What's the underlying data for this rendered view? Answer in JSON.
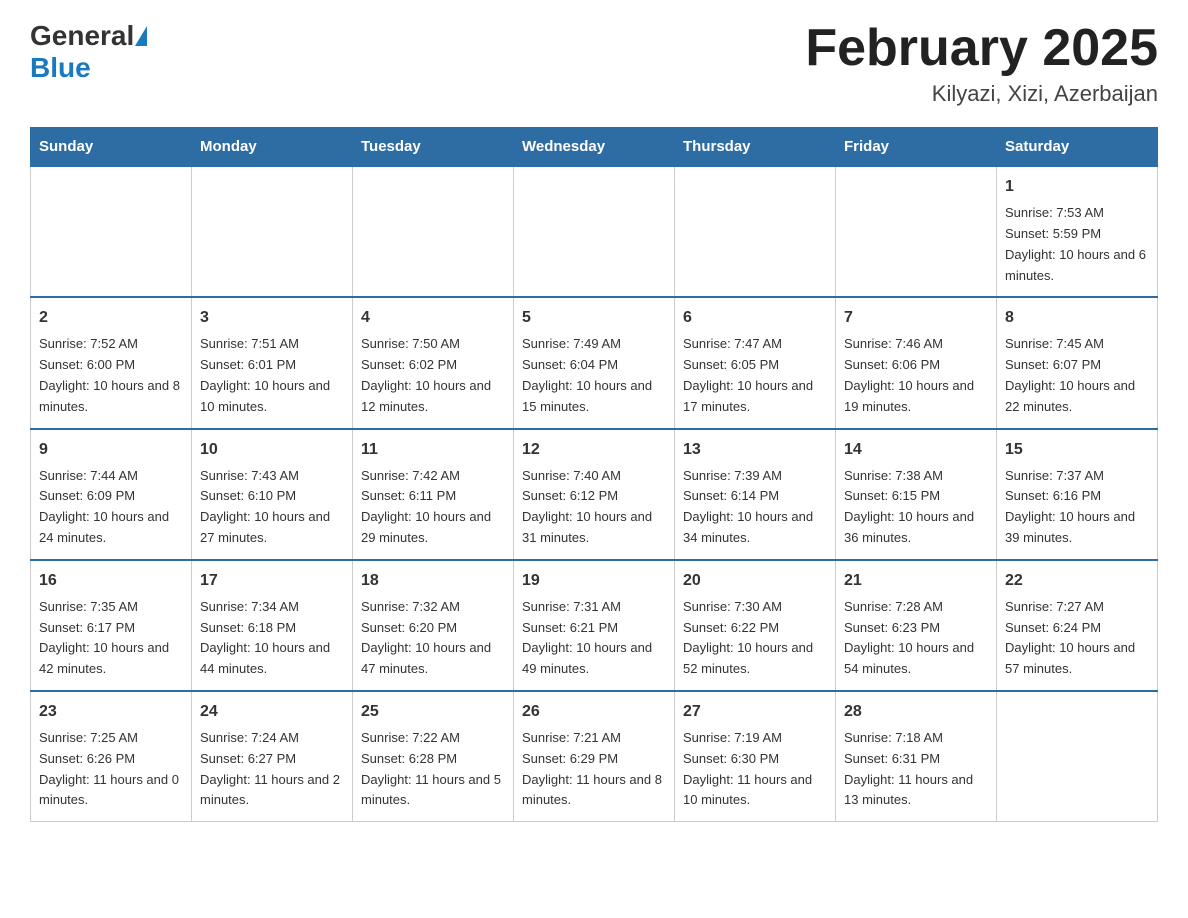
{
  "header": {
    "logo_general": "General",
    "logo_blue": "Blue",
    "title": "February 2025",
    "subtitle": "Kilyazi, Xizi, Azerbaijan"
  },
  "days_of_week": [
    "Sunday",
    "Monday",
    "Tuesday",
    "Wednesday",
    "Thursday",
    "Friday",
    "Saturday"
  ],
  "weeks": [
    [
      {
        "day": "",
        "sunrise": "",
        "sunset": "",
        "daylight": ""
      },
      {
        "day": "",
        "sunrise": "",
        "sunset": "",
        "daylight": ""
      },
      {
        "day": "",
        "sunrise": "",
        "sunset": "",
        "daylight": ""
      },
      {
        "day": "",
        "sunrise": "",
        "sunset": "",
        "daylight": ""
      },
      {
        "day": "",
        "sunrise": "",
        "sunset": "",
        "daylight": ""
      },
      {
        "day": "",
        "sunrise": "",
        "sunset": "",
        "daylight": ""
      },
      {
        "day": "1",
        "sunrise": "Sunrise: 7:53 AM",
        "sunset": "Sunset: 5:59 PM",
        "daylight": "Daylight: 10 hours and 6 minutes."
      }
    ],
    [
      {
        "day": "2",
        "sunrise": "Sunrise: 7:52 AM",
        "sunset": "Sunset: 6:00 PM",
        "daylight": "Daylight: 10 hours and 8 minutes."
      },
      {
        "day": "3",
        "sunrise": "Sunrise: 7:51 AM",
        "sunset": "Sunset: 6:01 PM",
        "daylight": "Daylight: 10 hours and 10 minutes."
      },
      {
        "day": "4",
        "sunrise": "Sunrise: 7:50 AM",
        "sunset": "Sunset: 6:02 PM",
        "daylight": "Daylight: 10 hours and 12 minutes."
      },
      {
        "day": "5",
        "sunrise": "Sunrise: 7:49 AM",
        "sunset": "Sunset: 6:04 PM",
        "daylight": "Daylight: 10 hours and 15 minutes."
      },
      {
        "day": "6",
        "sunrise": "Sunrise: 7:47 AM",
        "sunset": "Sunset: 6:05 PM",
        "daylight": "Daylight: 10 hours and 17 minutes."
      },
      {
        "day": "7",
        "sunrise": "Sunrise: 7:46 AM",
        "sunset": "Sunset: 6:06 PM",
        "daylight": "Daylight: 10 hours and 19 minutes."
      },
      {
        "day": "8",
        "sunrise": "Sunrise: 7:45 AM",
        "sunset": "Sunset: 6:07 PM",
        "daylight": "Daylight: 10 hours and 22 minutes."
      }
    ],
    [
      {
        "day": "9",
        "sunrise": "Sunrise: 7:44 AM",
        "sunset": "Sunset: 6:09 PM",
        "daylight": "Daylight: 10 hours and 24 minutes."
      },
      {
        "day": "10",
        "sunrise": "Sunrise: 7:43 AM",
        "sunset": "Sunset: 6:10 PM",
        "daylight": "Daylight: 10 hours and 27 minutes."
      },
      {
        "day": "11",
        "sunrise": "Sunrise: 7:42 AM",
        "sunset": "Sunset: 6:11 PM",
        "daylight": "Daylight: 10 hours and 29 minutes."
      },
      {
        "day": "12",
        "sunrise": "Sunrise: 7:40 AM",
        "sunset": "Sunset: 6:12 PM",
        "daylight": "Daylight: 10 hours and 31 minutes."
      },
      {
        "day": "13",
        "sunrise": "Sunrise: 7:39 AM",
        "sunset": "Sunset: 6:14 PM",
        "daylight": "Daylight: 10 hours and 34 minutes."
      },
      {
        "day": "14",
        "sunrise": "Sunrise: 7:38 AM",
        "sunset": "Sunset: 6:15 PM",
        "daylight": "Daylight: 10 hours and 36 minutes."
      },
      {
        "day": "15",
        "sunrise": "Sunrise: 7:37 AM",
        "sunset": "Sunset: 6:16 PM",
        "daylight": "Daylight: 10 hours and 39 minutes."
      }
    ],
    [
      {
        "day": "16",
        "sunrise": "Sunrise: 7:35 AM",
        "sunset": "Sunset: 6:17 PM",
        "daylight": "Daylight: 10 hours and 42 minutes."
      },
      {
        "day": "17",
        "sunrise": "Sunrise: 7:34 AM",
        "sunset": "Sunset: 6:18 PM",
        "daylight": "Daylight: 10 hours and 44 minutes."
      },
      {
        "day": "18",
        "sunrise": "Sunrise: 7:32 AM",
        "sunset": "Sunset: 6:20 PM",
        "daylight": "Daylight: 10 hours and 47 minutes."
      },
      {
        "day": "19",
        "sunrise": "Sunrise: 7:31 AM",
        "sunset": "Sunset: 6:21 PM",
        "daylight": "Daylight: 10 hours and 49 minutes."
      },
      {
        "day": "20",
        "sunrise": "Sunrise: 7:30 AM",
        "sunset": "Sunset: 6:22 PM",
        "daylight": "Daylight: 10 hours and 52 minutes."
      },
      {
        "day": "21",
        "sunrise": "Sunrise: 7:28 AM",
        "sunset": "Sunset: 6:23 PM",
        "daylight": "Daylight: 10 hours and 54 minutes."
      },
      {
        "day": "22",
        "sunrise": "Sunrise: 7:27 AM",
        "sunset": "Sunset: 6:24 PM",
        "daylight": "Daylight: 10 hours and 57 minutes."
      }
    ],
    [
      {
        "day": "23",
        "sunrise": "Sunrise: 7:25 AM",
        "sunset": "Sunset: 6:26 PM",
        "daylight": "Daylight: 11 hours and 0 minutes."
      },
      {
        "day": "24",
        "sunrise": "Sunrise: 7:24 AM",
        "sunset": "Sunset: 6:27 PM",
        "daylight": "Daylight: 11 hours and 2 minutes."
      },
      {
        "day": "25",
        "sunrise": "Sunrise: 7:22 AM",
        "sunset": "Sunset: 6:28 PM",
        "daylight": "Daylight: 11 hours and 5 minutes."
      },
      {
        "day": "26",
        "sunrise": "Sunrise: 7:21 AM",
        "sunset": "Sunset: 6:29 PM",
        "daylight": "Daylight: 11 hours and 8 minutes."
      },
      {
        "day": "27",
        "sunrise": "Sunrise: 7:19 AM",
        "sunset": "Sunset: 6:30 PM",
        "daylight": "Daylight: 11 hours and 10 minutes."
      },
      {
        "day": "28",
        "sunrise": "Sunrise: 7:18 AM",
        "sunset": "Sunset: 6:31 PM",
        "daylight": "Daylight: 11 hours and 13 minutes."
      },
      {
        "day": "",
        "sunrise": "",
        "sunset": "",
        "daylight": ""
      }
    ]
  ]
}
